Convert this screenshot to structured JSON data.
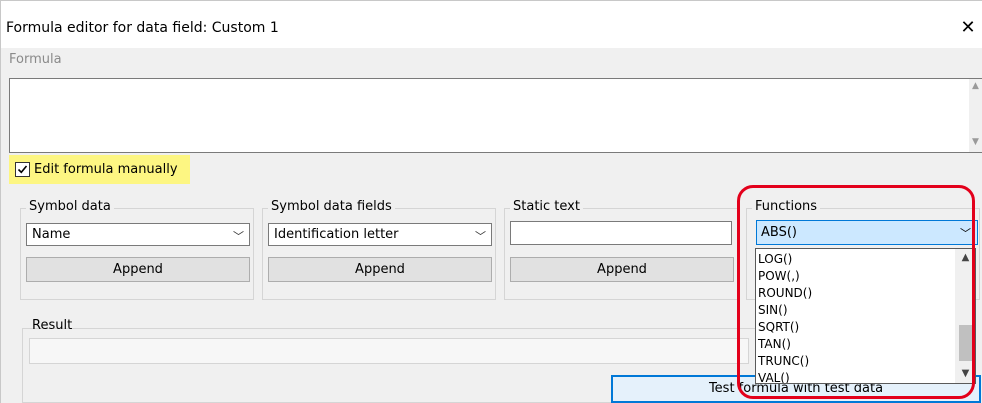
{
  "window": {
    "title": "Formula editor for data field: Custom 1",
    "close_glyph": "✕"
  },
  "formula": {
    "group_label": "Formula",
    "value": ""
  },
  "edit_manually": {
    "label": "Edit formula manually",
    "checked": true,
    "highlight_color": "#fdf682"
  },
  "symbol_data": {
    "label": "Symbol data",
    "selected": "Name",
    "append_label": "Append"
  },
  "symbol_data_fields": {
    "label": "Symbol data fields",
    "selected": "Identification letter",
    "append_label": "Append"
  },
  "static_text": {
    "label": "Static text",
    "value": "",
    "append_label": "Append"
  },
  "functions": {
    "label": "Functions",
    "selected": "ABS()",
    "options": [
      "LOG()",
      "POW(,)",
      "ROUND()",
      "SIN()",
      "SQRT()",
      "TAN()",
      "TRUNC()",
      "VAL()"
    ]
  },
  "result": {
    "label": "Result",
    "value": ""
  },
  "test_button": {
    "label": "Test formula with test data"
  },
  "colors": {
    "annotation_ring": "#e3001b",
    "focus_blue": "#0078d7",
    "selection_bg": "#cce8ff"
  }
}
